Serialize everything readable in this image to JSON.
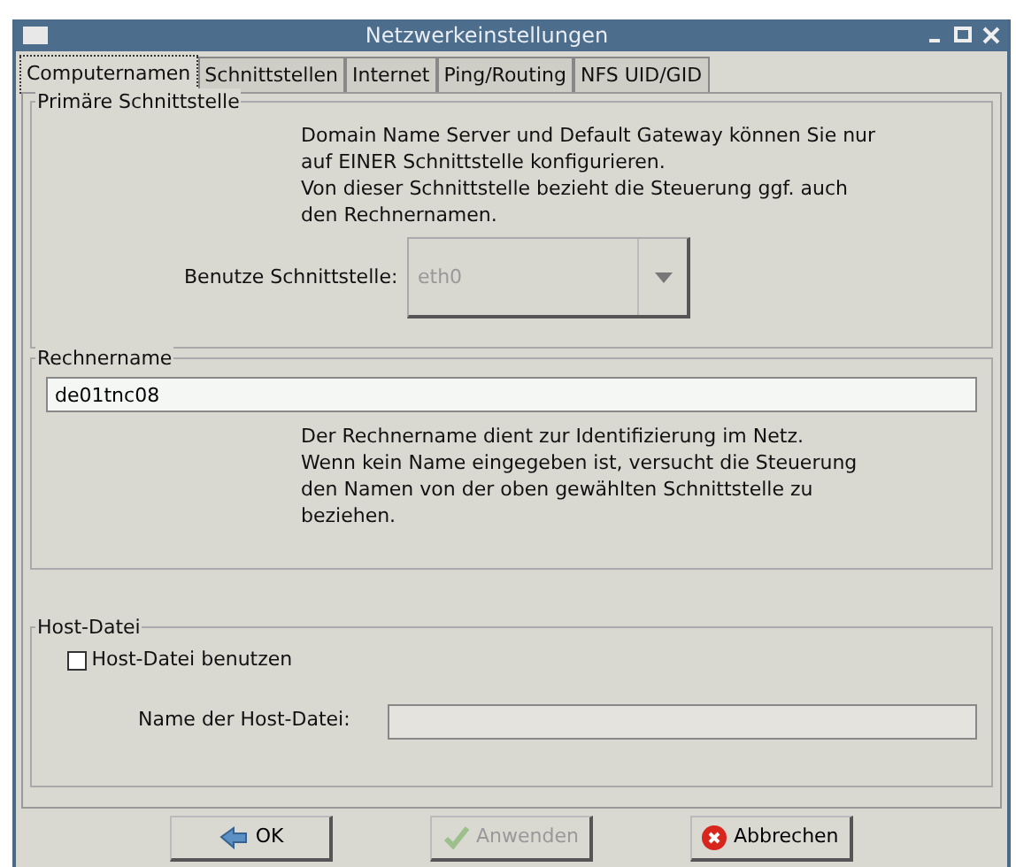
{
  "window": {
    "title": "Netzwerkeinstellungen"
  },
  "tabs": [
    {
      "label": "Computernamen",
      "selected": true
    },
    {
      "label": "Schnittstellen",
      "selected": false
    },
    {
      "label": "Internet",
      "selected": false
    },
    {
      "label": "Ping/Routing",
      "selected": false
    },
    {
      "label": "NFS UID/GID",
      "selected": false
    }
  ],
  "primary_interface": {
    "title": "Primäre Schnittstelle",
    "info": [
      "Domain Name Server und Default Gateway können Sie nur",
      "auf EINER Schnittstelle konfigurieren.",
      "Von dieser Schnittstelle bezieht die Steuerung ggf. auch",
      "den Rechnernamen."
    ],
    "label": "Benutze Schnittstelle:",
    "value": "eth0",
    "disabled": true
  },
  "hostname": {
    "title": "Rechnername",
    "value": "de01tnc08",
    "info": [
      "Der Rechnername dient zur Identifizierung im Netz.",
      "Wenn kein Name eingegeben ist, versucht die Steuerung",
      "den Namen von der oben gewählten Schnittstelle zu",
      "beziehen."
    ]
  },
  "host_file": {
    "title": "Host-Datei",
    "checkbox": {
      "label": "Host-Datei benutzen",
      "checked": false
    },
    "label": "Name der Host-Datei:",
    "disabled": true
  },
  "buttons": [
    {
      "label": "OK",
      "kind": "ok",
      "disabled": false
    },
    {
      "label": "Anwenden",
      "kind": "apply",
      "disabled": true
    },
    {
      "label": "Abbrechen",
      "kind": "cancel",
      "disabled": false
    }
  ]
}
